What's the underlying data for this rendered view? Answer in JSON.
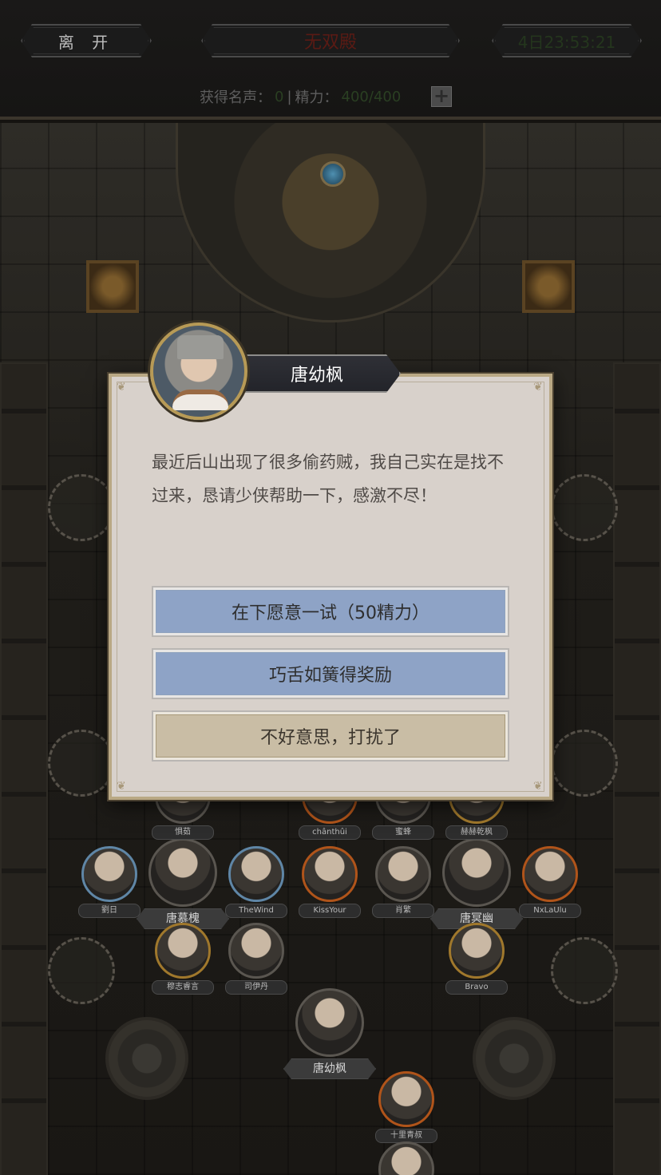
{
  "header": {
    "leave_label": "离 开",
    "title": "无双殿",
    "timer": "4日23:53:21",
    "reputation_label": "获得名声：",
    "reputation_value": "0",
    "separator": " | ",
    "energy_label": "精力：",
    "energy_value": "400/400",
    "plus_label": "+"
  },
  "dialog": {
    "npc_name": "唐幼枫",
    "text": "最近后山出现了很多偷药贼，我自己实在是找不过来，恳请少侠帮助一下，感激不尽！",
    "choices": [
      {
        "label": "在下愿意一试（50精力）",
        "style": "blue"
      },
      {
        "label": "巧舌如簧得奖励",
        "style": "blue"
      },
      {
        "label": "不好意思，打扰了",
        "style": "beige"
      }
    ]
  },
  "board": {
    "row1": [
      "惧茹",
      "chânthûi",
      "蜜蜂",
      "赫赫乾枫"
    ],
    "row2": [
      {
        "name": "劉日",
        "size": "small"
      },
      {
        "name": "唐慕槐",
        "size": "big"
      },
      {
        "name": "TheWind",
        "size": "small"
      },
      {
        "name": "KissYour",
        "size": "small"
      },
      {
        "name": "肖繁",
        "size": "small"
      },
      {
        "name": "唐冥幽",
        "size": "big"
      },
      {
        "name": "NxLaUlu",
        "size": "small"
      }
    ],
    "row3": [
      "穆志睿言",
      "司伊丹",
      "Bravo"
    ],
    "center_name": "唐幼枫",
    "bottom_name": "十里青叔"
  },
  "colors": {
    "dialog_bg": "#d8d1cb",
    "choice_blue": "#8ea3c6",
    "choice_beige": "#c9bda5",
    "title_red": "#5a1a14",
    "timer_green": "#24361d"
  }
}
